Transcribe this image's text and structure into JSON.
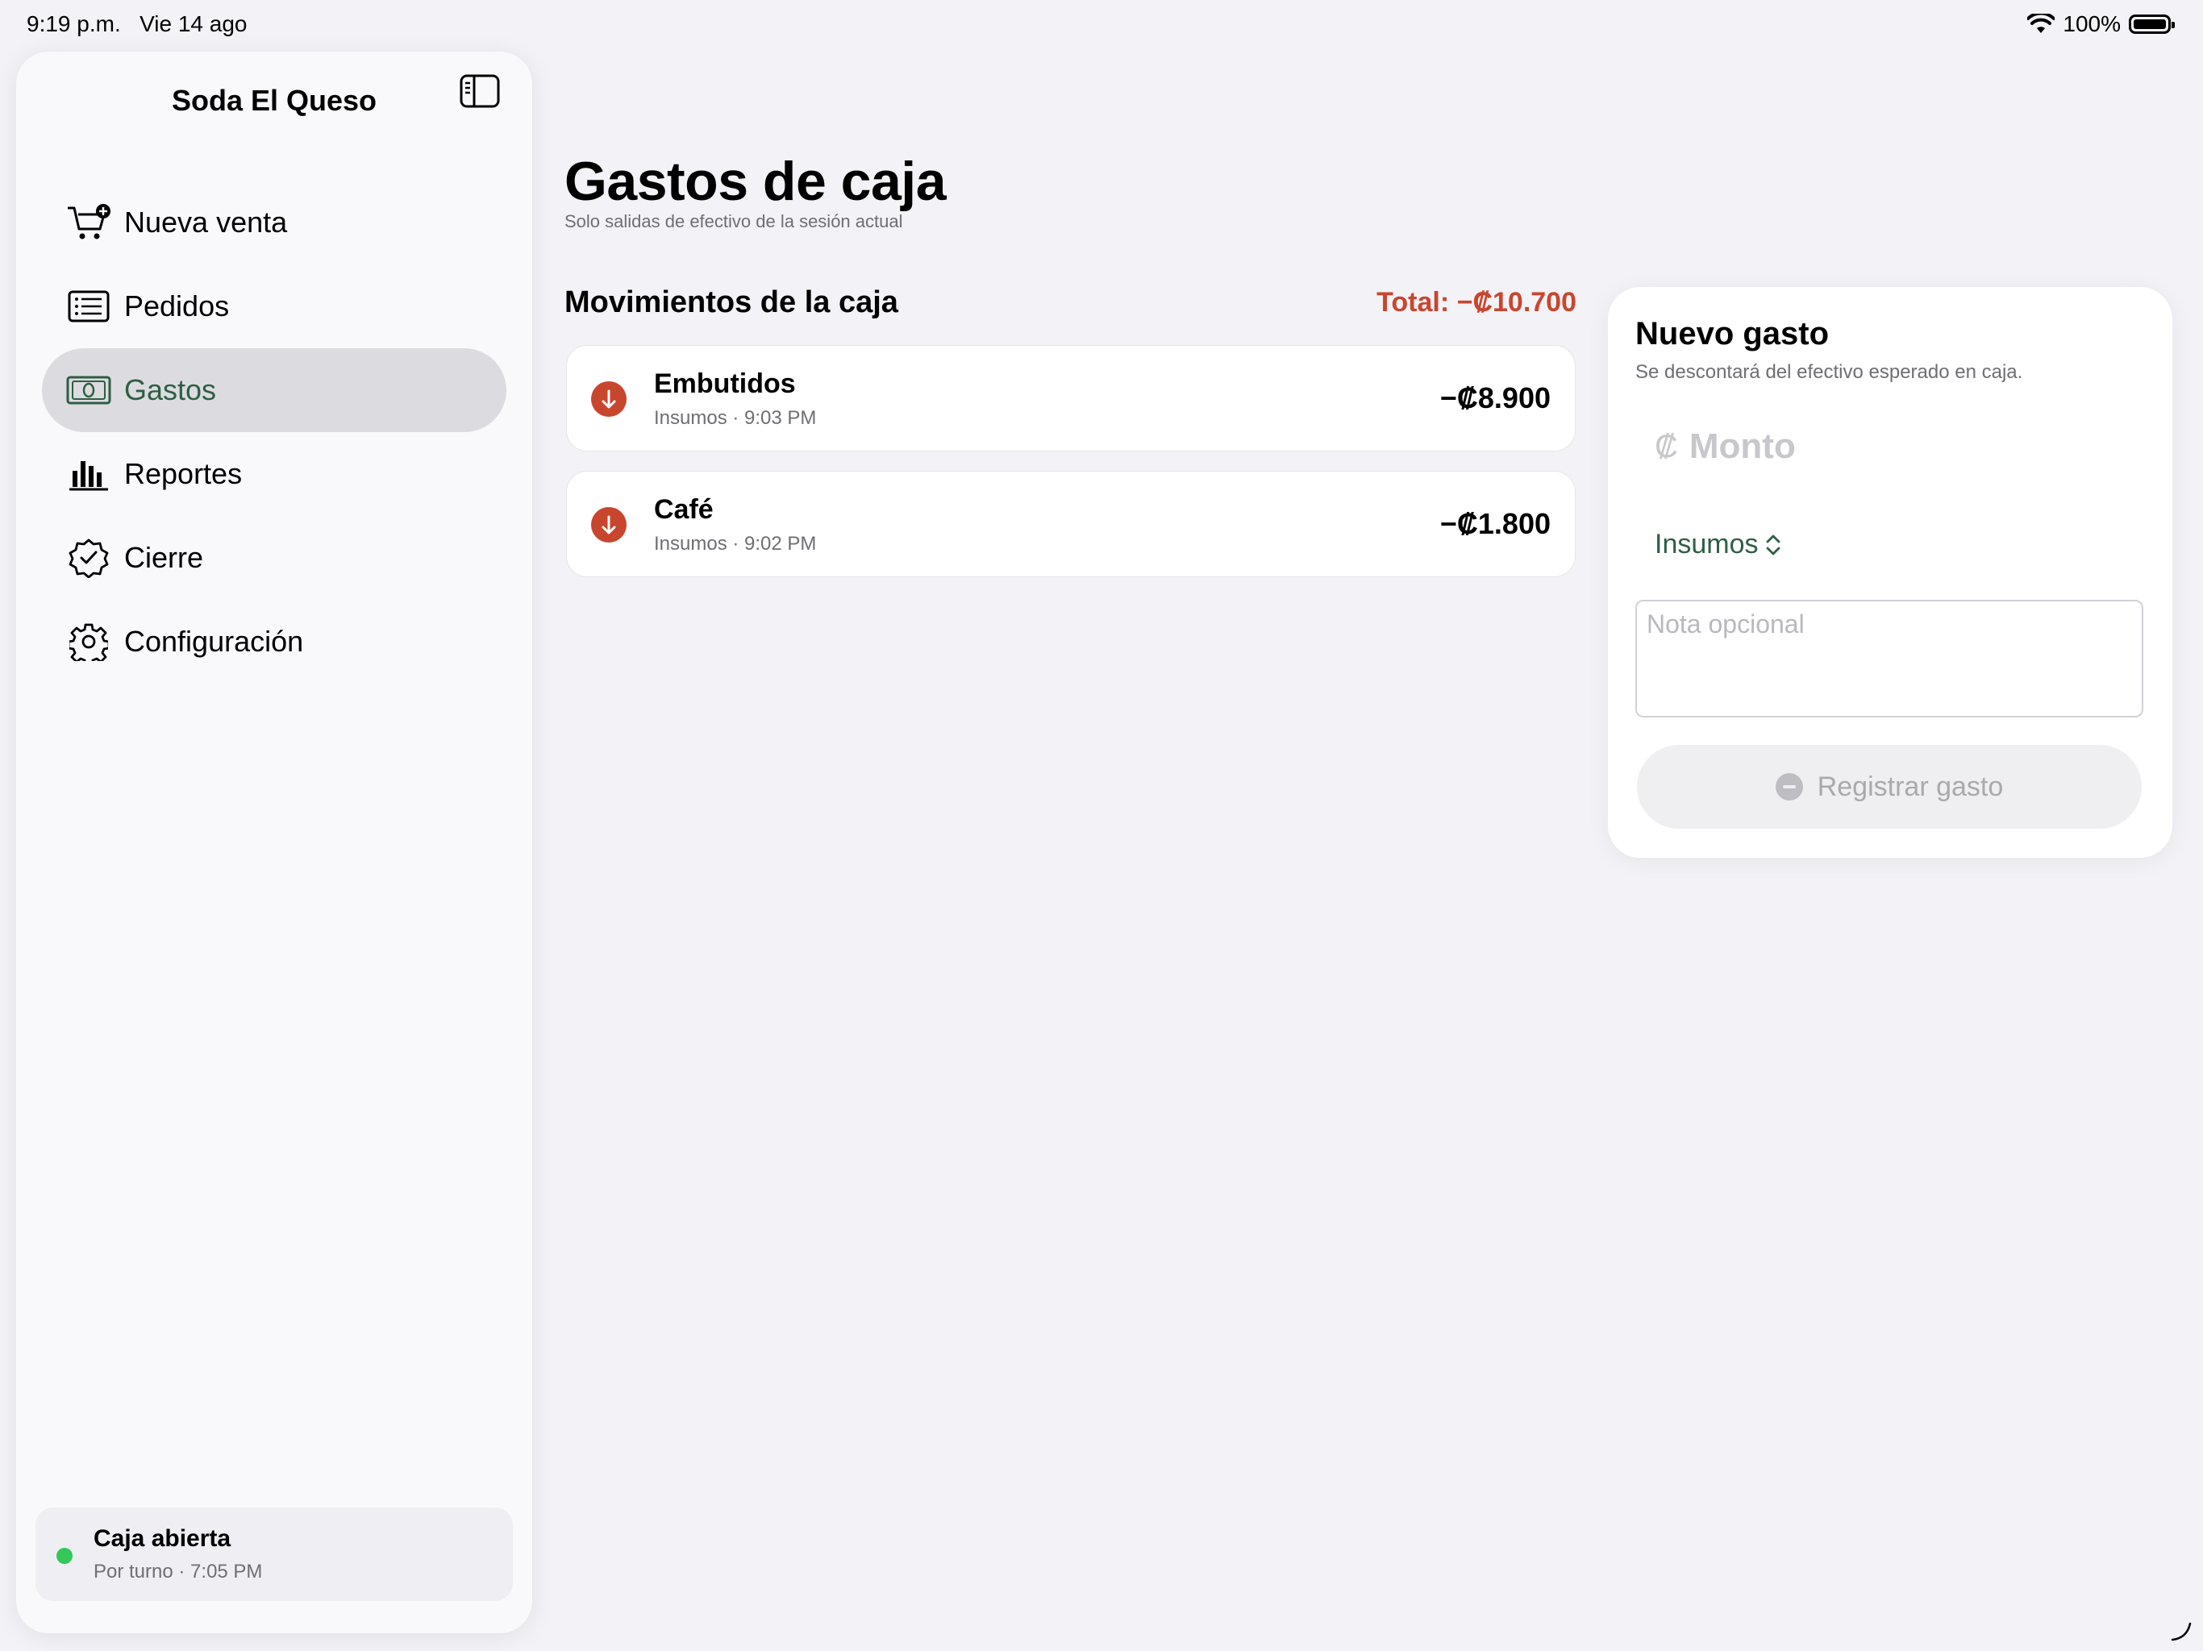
{
  "status_bar": {
    "time": "9:19 p.m.",
    "date": "Vie 14 ago",
    "battery": "100%"
  },
  "sidebar": {
    "title": "Soda El Queso",
    "items": [
      {
        "label": "Nueva venta",
        "icon": "cart-plus-icon"
      },
      {
        "label": "Pedidos",
        "icon": "list-icon"
      },
      {
        "label": "Gastos",
        "icon": "banknote-icon",
        "active": true
      },
      {
        "label": "Reportes",
        "icon": "bar-chart-icon"
      },
      {
        "label": "Cierre",
        "icon": "checkmark-seal-icon"
      },
      {
        "label": "Configuración",
        "icon": "gear-icon"
      }
    ],
    "caja": {
      "title": "Caja abierta",
      "subtitle": "Por turno · 7:05 PM"
    }
  },
  "main": {
    "title": "Gastos de caja",
    "subtitle": "Solo salidas de efectivo de la sesión actual",
    "section_title": "Movimientos de la caja",
    "total": "Total: −₡10.700",
    "movements": [
      {
        "name": "Embutidos",
        "meta": "Insumos · 9:03 PM",
        "amount": "−₡8.900"
      },
      {
        "name": "Café",
        "meta": "Insumos · 9:02 PM",
        "amount": "−₡1.800"
      }
    ]
  },
  "form": {
    "title": "Nuevo gasto",
    "subtitle": "Se descontará del efectivo esperado en caja.",
    "currency_symbol": "₡",
    "amount_placeholder": "Monto",
    "category": "Insumos",
    "note_placeholder": "Nota opcional",
    "submit_label": "Registrar gasto"
  },
  "colors": {
    "accent": "#2E5E45",
    "negative": "#C8462E",
    "open_status": "#34C759"
  }
}
